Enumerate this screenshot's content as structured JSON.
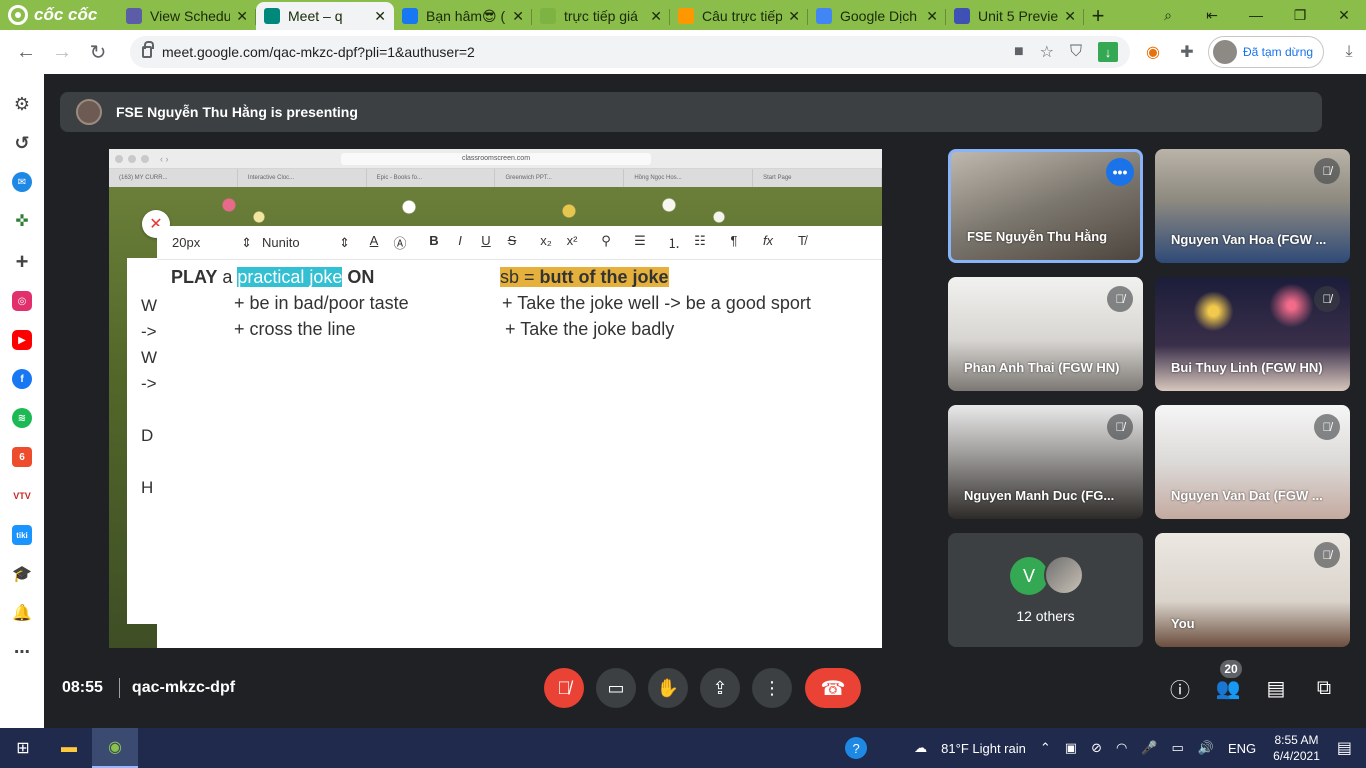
{
  "browser": {
    "brand": "cốc cốc",
    "tabs": [
      {
        "title": "View Schedu",
        "color": "#5b5ea6",
        "active": false
      },
      {
        "title": "Meet – q",
        "color": "#00897b",
        "active": true
      },
      {
        "title": "Bạn hâm😎 (",
        "color": "#1877f2",
        "active": false
      },
      {
        "title": "trực tiếp giá",
        "color": "#7cb342",
        "active": false
      },
      {
        "title": "Câu trực tiếp",
        "color": "#ff9800",
        "active": false
      },
      {
        "title": "Google Dịch",
        "color": "#4285f4",
        "active": false
      },
      {
        "title": "Unit 5 Previe",
        "color": "#3f51b5",
        "active": false
      }
    ],
    "tab_close": "✕",
    "new_tab": "+",
    "url": "meet.google.com/qac-mkzc-dpf?pli=1&authuser=2",
    "profile_status": "Đã tạm dừng"
  },
  "meet": {
    "presenting_banner": "FSE Nguyễn Thu Hằng is presenting",
    "shared_screen": {
      "url": "classroomscreen.com",
      "tabs": [
        "(163) MY CURR...",
        "Interactive Cloc...",
        "Epic - Books fo...",
        "Greenwich PPT...",
        "Hồng Ngọc Hos...",
        "Start Page"
      ],
      "toolbar": {
        "font_size": "20px",
        "font_family": "Nunito"
      },
      "behind_letters": [
        "W",
        "->",
        "W",
        "->",
        "D",
        "H"
      ],
      "note": {
        "l1_a": "PLAY",
        "l1_b": " a ",
        "l1_hl": "practical joke",
        "l1_c": " ON",
        "l2": "+ be in bad/poor taste",
        "l3": "+ cross the line",
        "r1_a": "sb = ",
        "r1_b": "butt of the joke",
        "r2": "+ Take the joke well -> be a good sport",
        "r3": "+ Take the joke badly"
      }
    },
    "participants": [
      {
        "name": "FSE Nguyễn Thu Hằng",
        "muted": false,
        "speaking": true
      },
      {
        "name": "Nguyen Van Hoa (FGW ...",
        "muted": true
      },
      {
        "name": "Phan Anh Thai (FGW HN)",
        "muted": true
      },
      {
        "name": "Bui Thuy Linh (FGW HN)",
        "muted": true
      },
      {
        "name": "Nguyen Manh Duc (FG...",
        "muted": true
      },
      {
        "name": "Nguyen Van Dat (FGW ...",
        "muted": true
      },
      {
        "name": "You",
        "muted": true
      }
    ],
    "others": {
      "initial": "V",
      "label": "12 others"
    },
    "footer": {
      "time": "08:55",
      "code": "qac-mkzc-dpf",
      "participant_count": "20"
    }
  },
  "taskbar": {
    "weather": "81°F  Light rain",
    "lang": "ENG",
    "time": "8:55 AM",
    "date": "6/4/2021"
  }
}
